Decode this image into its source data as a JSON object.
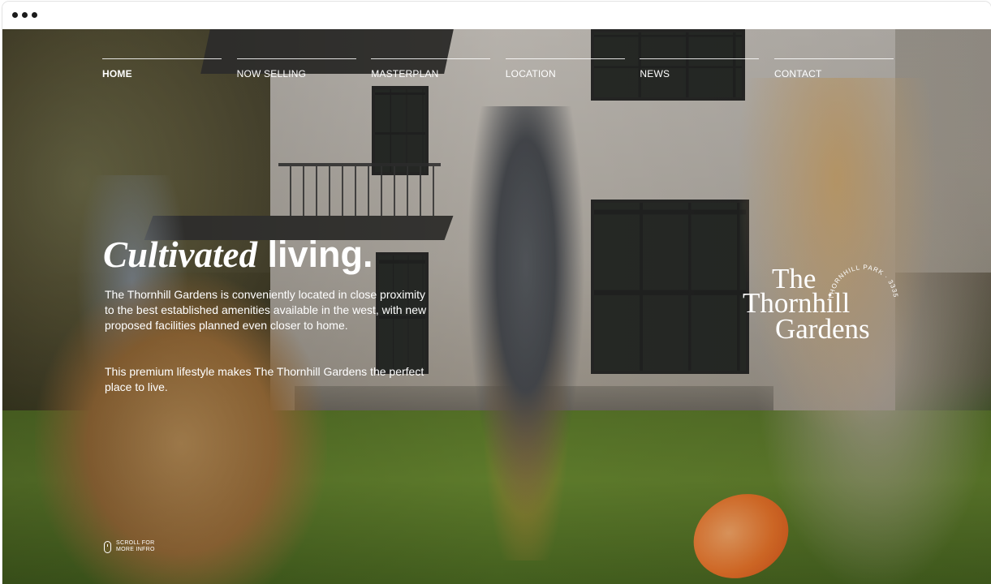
{
  "window": {
    "controls": [
      "dot",
      "dot",
      "dot"
    ]
  },
  "nav": {
    "items": [
      {
        "label": "HOME",
        "active": true
      },
      {
        "label": "NOW SELLING",
        "active": false
      },
      {
        "label": "MASTERPLAN",
        "active": false
      },
      {
        "label": "LOCATION",
        "active": false
      },
      {
        "label": "NEWS",
        "active": false
      },
      {
        "label": "CONTACT",
        "active": false
      }
    ]
  },
  "hero": {
    "headline_italic": "Cultivated",
    "headline_regular": "living.",
    "paragraph_1": "The Thornhill Gardens is conveniently located in close proximity to the best established amenities available in the west, with new proposed facilities planned even closer to home.",
    "paragraph_2": "This premium lifestyle makes The Thornhill Gardens the perfect place to live."
  },
  "logo": {
    "line_1": "The",
    "line_2": "Thornhill",
    "line_3": "Gardens",
    "ring_text": "THORNHILL PARK · 3335"
  },
  "scroll_hint": {
    "line_1": "SCROLL FOR",
    "line_2": "MORE INFRO"
  },
  "colors": {
    "text": "#ffffff",
    "frisbee": "#f47a2c",
    "lawn": "#5f7e2c"
  }
}
